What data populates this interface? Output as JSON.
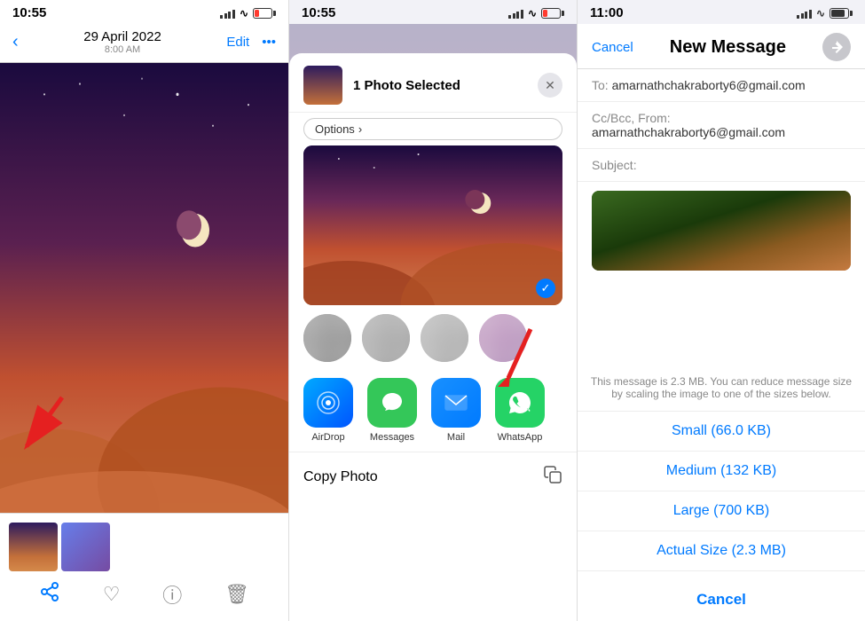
{
  "panel1": {
    "status_time": "10:55",
    "date": "29 April 2022",
    "time_sub": "8:00 AM",
    "edit_label": "Edit",
    "more_label": "•••"
  },
  "panel2": {
    "status_time": "10:55",
    "sheet_title": "1 Photo Selected",
    "options_label": "Options",
    "close_label": "×",
    "app_icons": [
      {
        "name": "AirDrop",
        "icon": "airdrop"
      },
      {
        "name": "Messages",
        "icon": "messages"
      },
      {
        "name": "Mail",
        "icon": "mail"
      },
      {
        "name": "WhatsApp",
        "icon": "whatsapp"
      }
    ],
    "copy_label": "Copy Photo"
  },
  "panel3": {
    "status_time": "11:00",
    "cancel_label": "Cancel",
    "title": "New Message",
    "to_label": "To:",
    "to_value": "amarnathchakraborty6@gmail.com",
    "cc_label": "Cc/Bcc, From:",
    "cc_value": "amarnathchakraborty6@gmail.com",
    "subject_label": "Subject:",
    "size_message": "This message is 2.3 MB. You can reduce message size by scaling the image to one of the sizes below.",
    "size_options": [
      "Small (66.0 KB)",
      "Medium (132 KB)",
      "Large (700 KB)",
      "Actual Size (2.3 MB)"
    ],
    "cancel_size_label": "Cancel"
  }
}
